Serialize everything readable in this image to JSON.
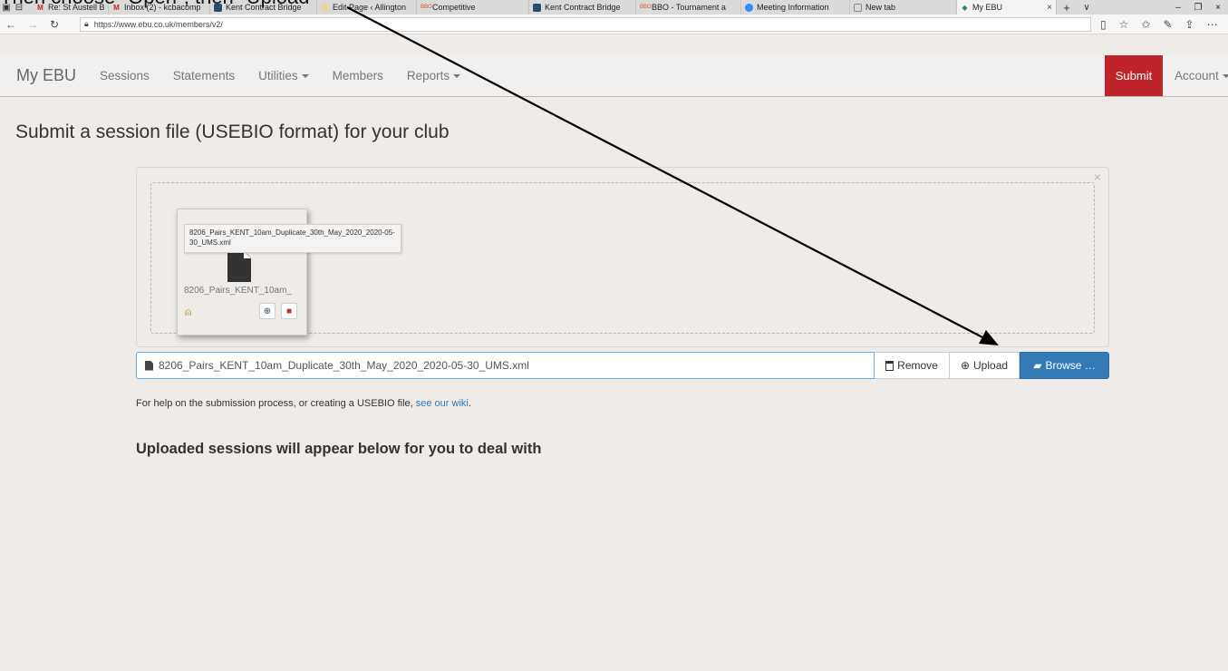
{
  "caption": "Then choose \"Open\", then \"Upload\"",
  "browser": {
    "tabs": [
      {
        "label": "Re: St Austell BC - st",
        "icon": "gmail-icon",
        "color": "#c5221f"
      },
      {
        "label": "Inbox (2) - kcbacomp",
        "icon": "gmail-icon",
        "color": "#c5221f"
      },
      {
        "label": "Kent Contract Bridge",
        "icon": "kcb-icon",
        "color": "#2b4b6b"
      },
      {
        "label": "Edit Page ‹ Allington",
        "icon": "wp-icon",
        "color": "#e8d8a0"
      },
      {
        "label": "Competitive",
        "icon": "bbo-icon",
        "color": "#d0571b"
      },
      {
        "label": "Kent Contract Bridge",
        "icon": "kcb-icon",
        "color": "#2b4b6b"
      },
      {
        "label": "BBO - Tournament a",
        "icon": "bbo-icon",
        "color": "#d0571b"
      },
      {
        "label": "Meeting Information",
        "icon": "zoom-icon",
        "color": "#2d8cff"
      },
      {
        "label": "New tab",
        "icon": "newtab-icon",
        "color": "#888888"
      },
      {
        "label": "My EBU",
        "icon": "ebu-icon",
        "color": "#2e8b57"
      }
    ],
    "url": "https://www.ebu.co.uk/members/v2/"
  },
  "navbar": {
    "brand": "My EBU",
    "items": [
      "Sessions",
      "Statements",
      "Utilities",
      "Members",
      "Reports"
    ],
    "submit": "Submit",
    "account": "Account"
  },
  "page": {
    "title": "Submit a session file (USEBIO format) for your club",
    "file_tooltip": "8206_Pairs_KENT_10am_Duplicate_30th_May_2020_2020-05-30_UMS.xml",
    "file_caption": "8206_Pairs_KENT_10am_",
    "file_field_value": "8206_Pairs_KENT_10am_Duplicate_30th_May_2020_2020-05-30_UMS.xml",
    "buttons": {
      "remove": "Remove",
      "upload": "Upload",
      "browse": "Browse …"
    },
    "help_text": "For help on the submission process, or creating a USEBIO file, ",
    "help_link": "see our wiki",
    "help_end": ".",
    "uploaded_heading": "Uploaded sessions will appear below for you to deal with"
  },
  "colors": {
    "accent": "#337ab7",
    "submit": "#bf2528"
  }
}
